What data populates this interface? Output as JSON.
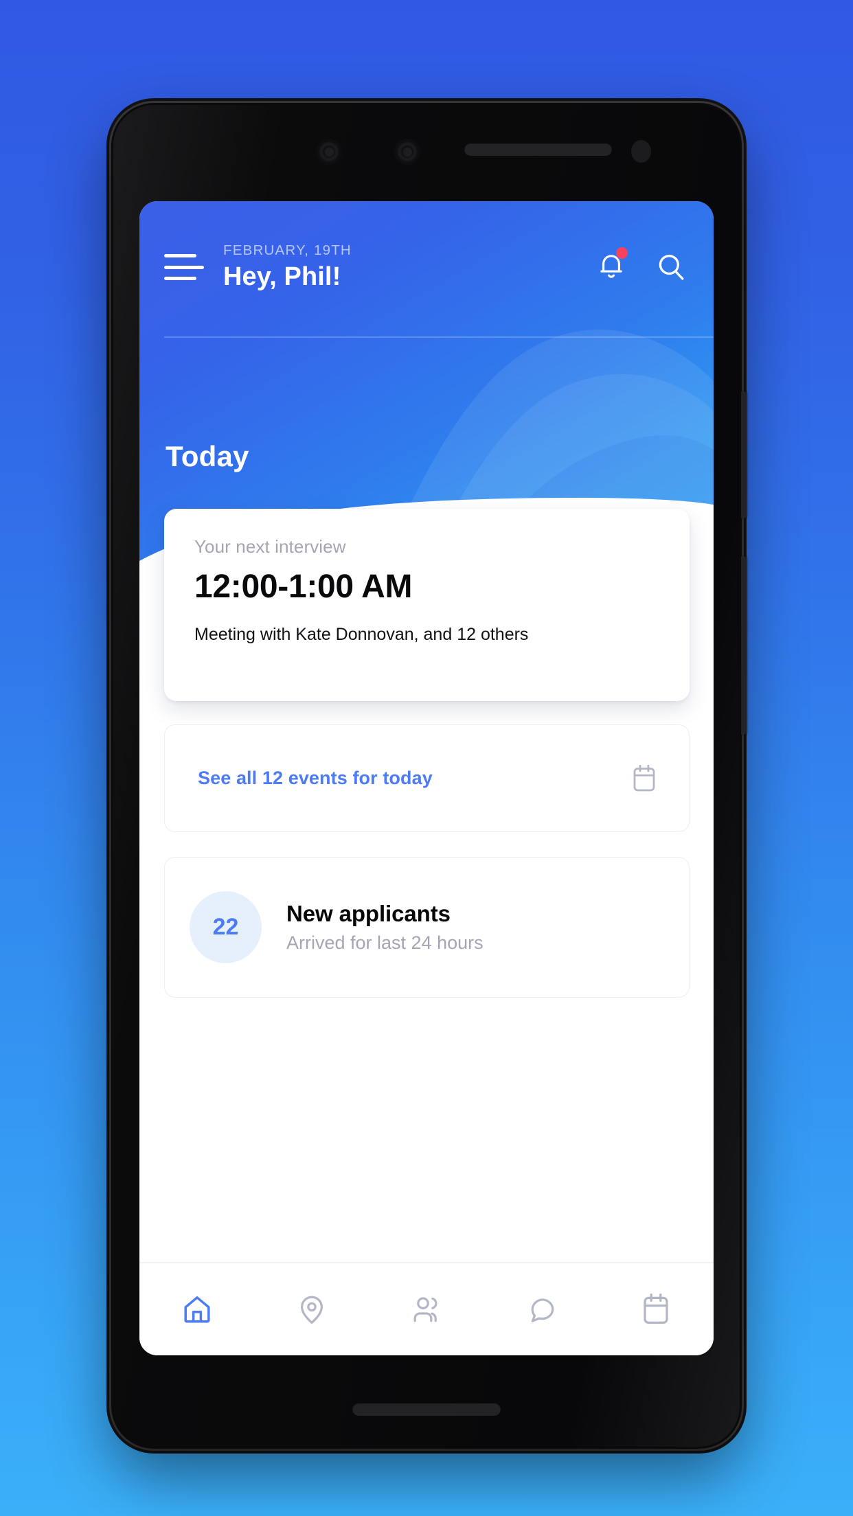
{
  "theme": {
    "page_bg_top": "#3059e3",
    "page_bg_bottom": "#3bb0f9",
    "hero_blue": "#3563e9",
    "hero_cyan": "#33a9f5",
    "accent_blue": "#4c7bf2",
    "notification_red": "#f6425f",
    "badge_bg": "#e6f0fd",
    "muted_text": "#a3a6b4",
    "card_border": "#edeef2"
  },
  "device": {
    "camera_lens_1": "camera-lens-icon",
    "camera_lens_2": "camera-lens-icon",
    "earpiece_speaker": "speaker-grille",
    "proximity_sensor": "proximity-sensor",
    "bottom_speaker": "speaker-grille",
    "side_button_volume": "volume-button",
    "side_button_power": "power-button"
  },
  "header": {
    "menu_icon": "hamburger-menu-icon",
    "date": "FEBRUARY, 19TH",
    "greeting": "Hey, Phil!",
    "notification_icon": "bell-icon",
    "has_notification": true,
    "search_icon": "search-icon"
  },
  "hero": {
    "title": "Today"
  },
  "interview_card": {
    "label": "Your next interview",
    "time": "12:00-1:00 AM",
    "attendees": "Meeting with Kate Donnovan, and 12 others"
  },
  "events_card": {
    "link_text": "See all 12 events for today",
    "icon": "calendar-icon"
  },
  "applicants_card": {
    "count": "22",
    "title": "New applicants",
    "subtitle": "Arrived for last 24 hours"
  },
  "bottom_nav": {
    "items": [
      {
        "name": "home",
        "icon": "home-icon",
        "active": true
      },
      {
        "name": "location",
        "icon": "map-pin-icon",
        "active": false
      },
      {
        "name": "people",
        "icon": "people-icon",
        "active": false
      },
      {
        "name": "messages",
        "icon": "chat-bubble-icon",
        "active": false
      },
      {
        "name": "calendar",
        "icon": "calendar-icon",
        "active": false
      }
    ]
  }
}
